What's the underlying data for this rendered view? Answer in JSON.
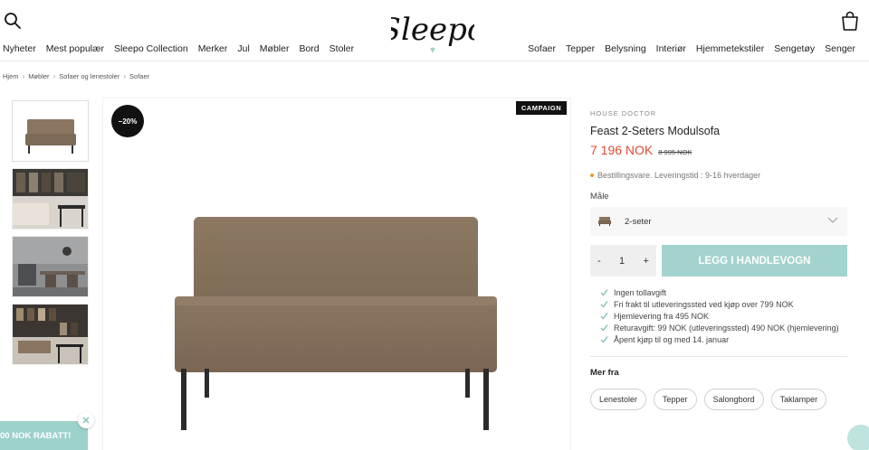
{
  "header": {
    "logo_text": "Sleepo",
    "nav_left": [
      "Nyheter",
      "Mest populær",
      "Sleepo Collection",
      "Merker",
      "Jul",
      "Møbler",
      "Bord",
      "Stoler"
    ],
    "nav_right": [
      "Sofaer",
      "Tepper",
      "Belysning",
      "Interiør",
      "Hjemmetekstiler",
      "Sengetøy",
      "Senger"
    ]
  },
  "breadcrumb": [
    "Hjem",
    "Møbler",
    "Sofaer og lenestoler",
    "Sofaer"
  ],
  "gallery": {
    "discount_badge": "−20%",
    "campaign_label": "CAMPAIGN",
    "thumbnail_count": 4
  },
  "product": {
    "brand": "HOUSE DOCTOR",
    "title": "Feast 2-Seters Modulsofa",
    "price_new": "7 196 NOK",
    "price_old": "8 995 NOK",
    "stock_status": "Bestillingsvare. Leveringstid : 9-16 hverdager",
    "size_label": "Måle",
    "size_selected": "2-seter",
    "quantity": "1",
    "qty_minus": "-",
    "qty_plus": "+",
    "add_to_cart": "LEGG I HANDLEVOGN"
  },
  "usps": [
    "Ingen tollavgift",
    "Fri frakt til utleveringssted ved kjøp over 799 NOK",
    "Hjemlevering fra 495 NOK",
    "Returavgift: 99 NOK (utleveringssted) 490 NOK (hjemlevering)",
    "Åpent kjøp til og med 14. januar"
  ],
  "more_from": {
    "title": "Mer fra",
    "chips": [
      "Lenestoler",
      "Tepper",
      "Salongbord",
      "Taklamper"
    ]
  },
  "promo": {
    "text": "00 NOK RABATT!"
  },
  "colors": {
    "accent": "#a3d3cd",
    "price": "#e04a2f",
    "stock_dot": "#f29b1f",
    "sofa": "#8a7561"
  }
}
